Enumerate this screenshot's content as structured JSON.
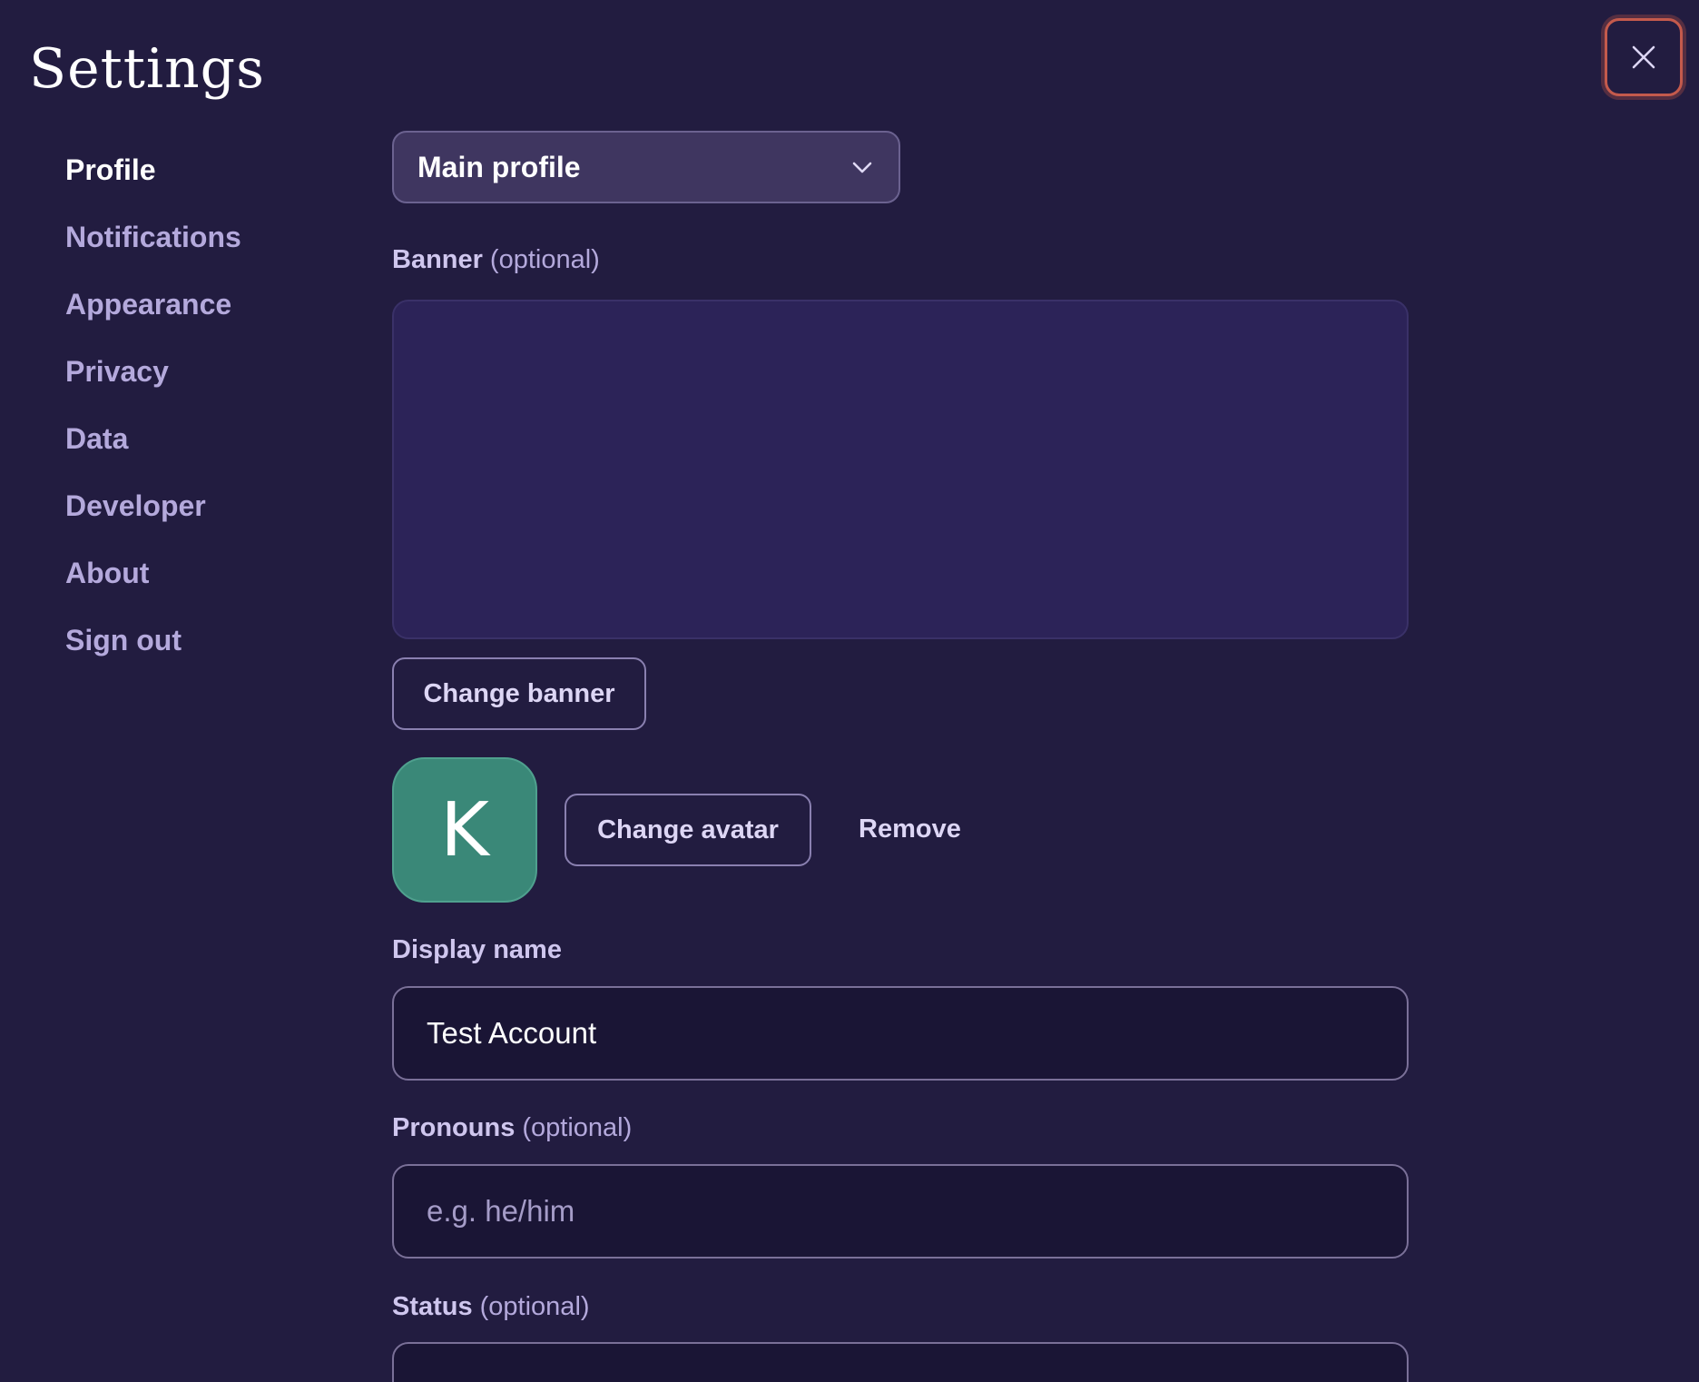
{
  "header": {
    "title": "Settings",
    "close_icon": "close-icon",
    "close_accent": "#c45a4c"
  },
  "sidebar": {
    "items": [
      {
        "label": "Profile",
        "active": true
      },
      {
        "label": "Notifications",
        "active": false
      },
      {
        "label": "Appearance",
        "active": false
      },
      {
        "label": "Privacy",
        "active": false
      },
      {
        "label": "Data",
        "active": false
      },
      {
        "label": "Developer",
        "active": false
      },
      {
        "label": "About",
        "active": false
      },
      {
        "label": "Sign out",
        "active": false
      }
    ]
  },
  "profile": {
    "profile_select": {
      "value": "Main profile",
      "icon": "chevron-down-icon"
    },
    "banner": {
      "label": "Banner",
      "optional_text": "(optional)",
      "change_button": "Change banner"
    },
    "avatar": {
      "letter": "K",
      "color": "#3a8878",
      "change_button": "Change avatar",
      "remove_button": "Remove"
    },
    "display_name": {
      "label": "Display name",
      "value": "Test Account"
    },
    "pronouns": {
      "label": "Pronouns",
      "optional_text": "(optional)",
      "value": "",
      "placeholder": "e.g. he/him"
    },
    "status": {
      "label": "Status",
      "optional_text": "(optional)"
    }
  },
  "colors": {
    "background": "#221c40",
    "nav_inactive": "#b4a9dc",
    "nav_active": "#ffffff",
    "banner_fill": "#2c2358",
    "input_fill": "#1a1535"
  }
}
